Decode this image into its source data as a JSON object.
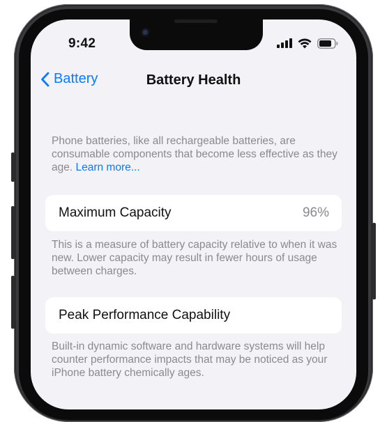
{
  "status_bar": {
    "time": "9:42"
  },
  "nav": {
    "back_label": "Battery",
    "title": "Battery Health"
  },
  "intro": {
    "text": "Phone batteries, like all rechargeable batteries, are consumable components that become less effective as they age.",
    "link_label": "Learn more..."
  },
  "maximum_capacity": {
    "label": "Maximum Capacity",
    "value": "96%",
    "description": "This is a measure of battery capacity relative to when it was new. Lower capacity may result in fewer hours of usage between charges."
  },
  "peak_performance": {
    "label": "Peak Performance Capability",
    "description": "Built-in dynamic software and hardware systems will help counter performance impacts that may be noticed as your iPhone battery chemically ages."
  },
  "colors": {
    "accent": "#0a7aff",
    "background": "#f2f2f7",
    "secondary_text": "#8a8a8e"
  },
  "icons": [
    "chevron-left-icon",
    "cellular-signal-icon",
    "wifi-icon",
    "battery-icon"
  ]
}
